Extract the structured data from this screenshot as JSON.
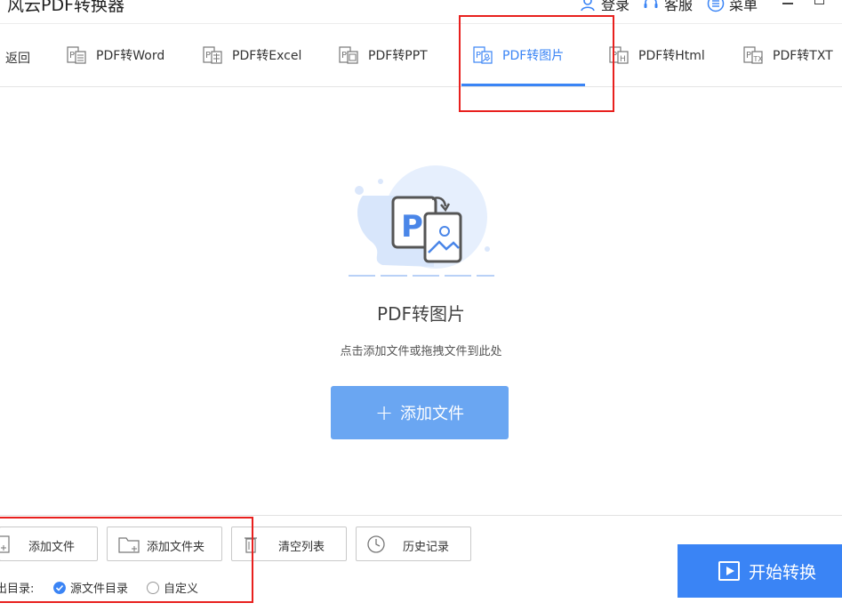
{
  "titlebar": {
    "app_title": "风云PDF转换器",
    "login": "登录",
    "service": "客服",
    "menu": "菜单"
  },
  "tabbar": {
    "back": "返回",
    "tabs": [
      {
        "label": "PDF转Word"
      },
      {
        "label": "PDF转Excel"
      },
      {
        "label": "PDF转PPT"
      },
      {
        "label": "PDF转图片",
        "active": true
      },
      {
        "label": "PDF转Html"
      },
      {
        "label": "PDF转TXT"
      }
    ]
  },
  "main": {
    "title": "PDF转图片",
    "hint": "点击添加文件或拖拽文件到此处",
    "add_file": "添加文件"
  },
  "bottom": {
    "add_file": "添加文件",
    "add_folder": "添加文件夹",
    "clear_list": "清空列表",
    "history": "历史记录",
    "output_dir_label": "出目录:",
    "source_dir": "源文件目录",
    "custom": "自定义",
    "start": "开始转换"
  },
  "colors": {
    "accent": "#3a84f5",
    "add_button": "#6aa6f2",
    "highlight_box": "#e8201e"
  }
}
